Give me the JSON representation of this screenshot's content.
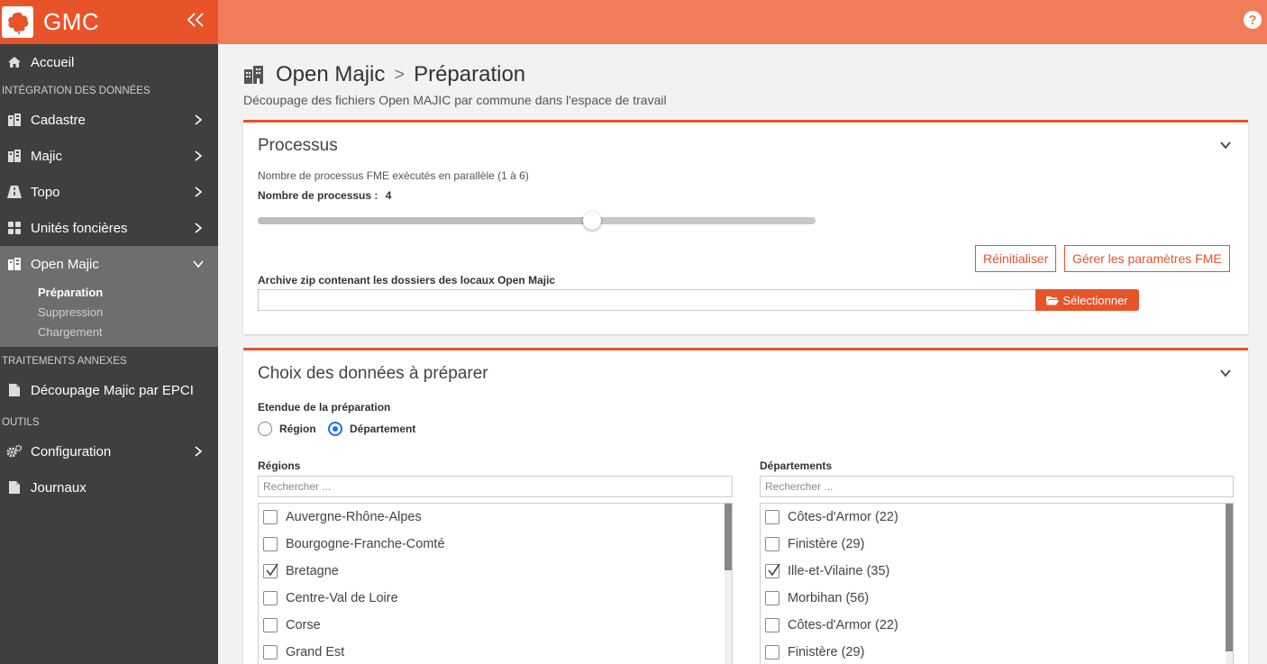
{
  "brand": {
    "name": "GMC"
  },
  "colors": {
    "accent": "#e8542a",
    "topbar": "#f07c59",
    "sidebar": "#3f3f3f",
    "active": "#6e6e6e",
    "radio": "#1a73e8"
  },
  "sidebar": {
    "home": "Accueil",
    "section_integration": "INTÉGRATION DES DONNÉES",
    "cadastre": "Cadastre",
    "majic": "Majic",
    "topo": "Topo",
    "unites": "Unités foncières",
    "openmajic": "Open Majic",
    "sub_preparation": "Préparation",
    "sub_suppression": "Suppression",
    "sub_chargement": "Chargement",
    "section_traitements": "TRAITEMENTS ANNEXES",
    "decoupage": "Découpage Majic par EPCI",
    "section_outils": "OUTILS",
    "configuration": "Configuration",
    "journaux": "Journaux"
  },
  "page": {
    "title_parent": "Open Majic",
    "separator": ">",
    "title_current": "Préparation",
    "subtitle": "Découpage des fichiers Open MAJIC par commune dans l'espace de travail"
  },
  "processus": {
    "title": "Processus",
    "hint": "Nombre de processus FME exécutés en parallèle (1 à 6)",
    "count_label": "Nombre de processus :",
    "count_value": "4",
    "slider": {
      "min": 1,
      "max": 6,
      "value": 4
    },
    "reset_button": "Réinitialiser",
    "fme_button": "Gérer les paramètres FME",
    "archive_label": "Archive zip contenant les dossiers des locaux Open Majic",
    "select_button": "Sélectionner"
  },
  "choix": {
    "title": "Choix des données à préparer",
    "etendue_label": "Etendue de la préparation",
    "radio_region": "Région",
    "radio_departement": "Département",
    "selected": "Département",
    "regions_label": "Régions",
    "departements_label": "Départements",
    "search_placeholder": "Rechercher ...",
    "regions": [
      {
        "label": "Auvergne-Rhône-Alpes",
        "checked": false
      },
      {
        "label": "Bourgogne-Franche-Comté",
        "checked": false
      },
      {
        "label": "Bretagne",
        "checked": true
      },
      {
        "label": "Centre-Val de Loire",
        "checked": false
      },
      {
        "label": "Corse",
        "checked": false
      },
      {
        "label": "Grand Est",
        "checked": false
      }
    ],
    "departements": [
      {
        "label": "Côtes-d'Armor (22)",
        "checked": false
      },
      {
        "label": "Finistère (29)",
        "checked": false
      },
      {
        "label": "Ille-et-Vilaine (35)",
        "checked": true
      },
      {
        "label": "Morbihan (56)",
        "checked": false
      },
      {
        "label": "Côtes-d'Armor (22)",
        "checked": false
      },
      {
        "label": "Finistère (29)",
        "checked": false
      }
    ]
  },
  "icons": {
    "help": "?"
  }
}
